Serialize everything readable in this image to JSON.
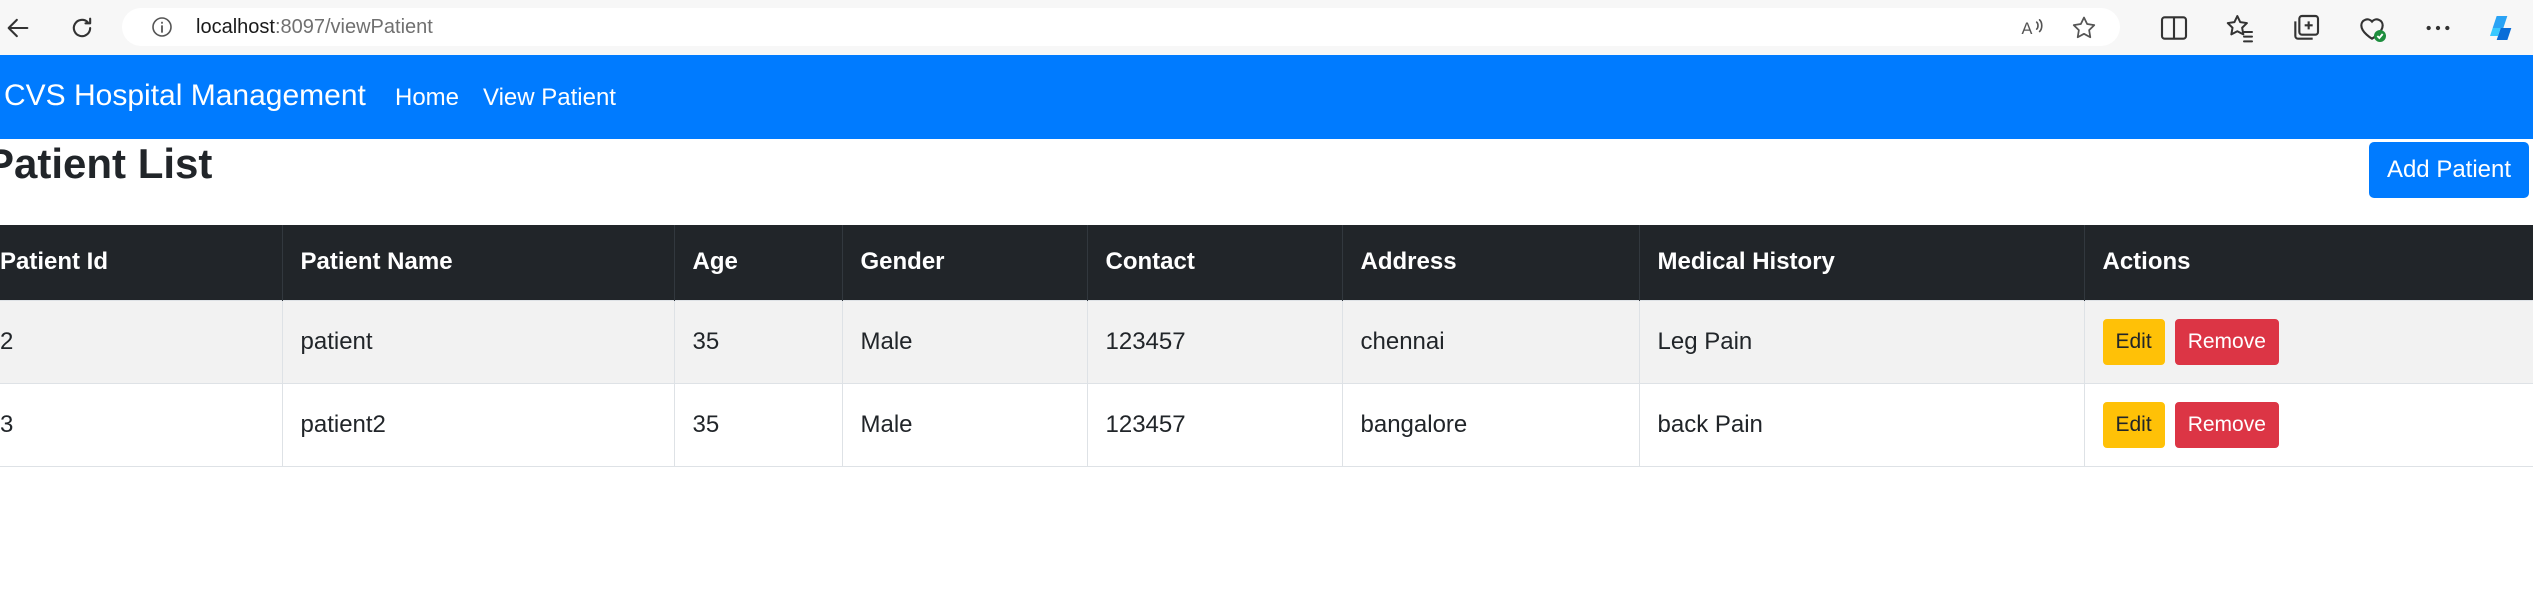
{
  "browser": {
    "url_host": "localhost",
    "url_path": ":8097/viewPatient"
  },
  "navbar": {
    "brand": "CVS Hospital Management",
    "links": [
      {
        "label": "Home"
      },
      {
        "label": "View Patient"
      }
    ],
    "background_color": "#007bff"
  },
  "page": {
    "title": "Patient List",
    "add_button_label": "Add Patient"
  },
  "table": {
    "headers": [
      "Patient Id",
      "Patient Name",
      "Age",
      "Gender",
      "Contact",
      "Address",
      "Medical History",
      "Actions"
    ],
    "rows": [
      {
        "id": "2",
        "name": "patient",
        "age": "35",
        "gender": "Male",
        "contact": "123457",
        "address": "chennai",
        "history": "Leg Pain",
        "edit_label": "Edit",
        "remove_label": "Remove"
      },
      {
        "id": "3",
        "name": "patient2",
        "age": "35",
        "gender": "Male",
        "contact": "123457",
        "address": "bangalore",
        "history": "back Pain",
        "edit_label": "Edit",
        "remove_label": "Remove"
      }
    ]
  },
  "colors": {
    "header_bg": "#212529",
    "edit_button": "#ffc107",
    "remove_button": "#dc3545"
  }
}
